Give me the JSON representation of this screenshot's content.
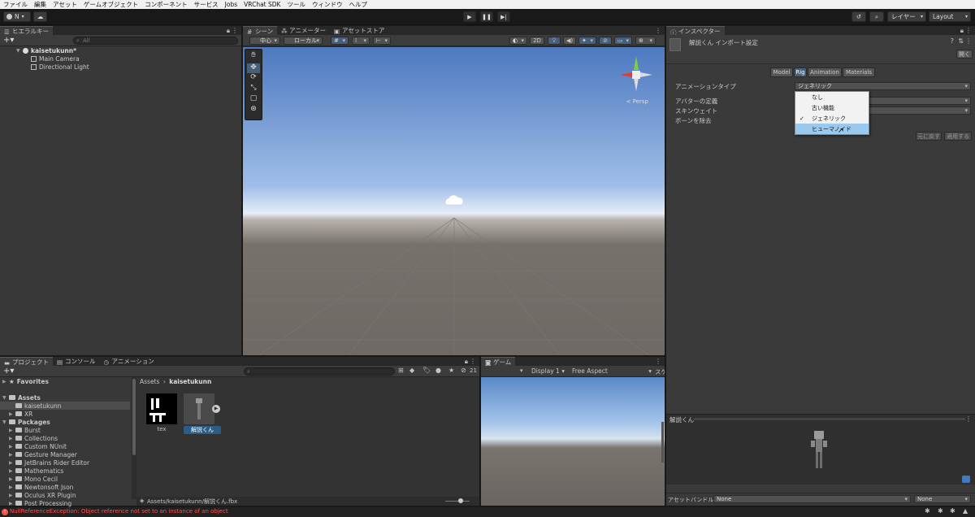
{
  "menu": [
    "ファイル",
    "編集",
    "アセット",
    "ゲームオブジェクト",
    "コンポーネント",
    "サービス",
    "Jobs",
    "VRChat SDK",
    "ツール",
    "ウィンドウ",
    "ヘルプ"
  ],
  "toolbar": {
    "account": "N",
    "layers": "レイヤー",
    "layout": "Layout"
  },
  "hierarchy": {
    "tab": "ヒエラルキー",
    "search_placeholder": "All",
    "items": [
      {
        "label": "kaisetukunn*",
        "bold": true
      },
      {
        "label": "Main Camera"
      },
      {
        "label": "Directional Light"
      }
    ]
  },
  "scene": {
    "tabs": [
      "シーン",
      "アニメーター",
      "アセットストア"
    ],
    "pivot": "中心",
    "space": "ローカル",
    "mode_2d": "2D",
    "persp": "< Persp"
  },
  "inspector": {
    "tab": "インスペクター",
    "title": "解説くん インポート設定",
    "open_button": "開く",
    "tabs": [
      "Model",
      "Rig",
      "Animation",
      "Materials"
    ],
    "active_tab": "Rig",
    "fields": [
      {
        "label": "アニメーションタイプ",
        "value": "ジェネリック"
      },
      {
        "label": "アバターの定義",
        "value": ""
      },
      {
        "label": "スキンウェイト",
        "value": ""
      },
      {
        "label": "ボーンを除去",
        "value": ""
      }
    ],
    "revert_button": "元に戻す",
    "apply_button": "適用する",
    "dropdown_options": [
      "なし",
      "古い機能",
      "ジェネリック",
      "ヒューマノイド"
    ],
    "checked_option": "ジェネリック",
    "highlighted_option": "ヒューマノイド",
    "preview_title": "解説くん",
    "asset_bundle_label": "アセットバンドル",
    "asset_bundle_value": "None",
    "asset_bundle_variant": "None"
  },
  "project": {
    "tabs": [
      "プロジェクト",
      "コンソール",
      "アニメーション"
    ],
    "badge_count": "21",
    "favorites": "Favorites",
    "assets": "Assets",
    "assets_children": [
      "kaisetukunn",
      "XR"
    ],
    "packages": "Packages",
    "packages_children": [
      "Burst",
      "Collections",
      "Custom NUnit",
      "Gesture Manager",
      "JetBrains Rider Editor",
      "Mathematics",
      "Mono Cecil",
      "Newtonsoft Json",
      "Oculus XR Plugin",
      "Post Processing"
    ],
    "breadcrumb_root": "Assets",
    "breadcrumb_current": "kaisetukunn",
    "files": [
      {
        "name": "tex"
      },
      {
        "name": "解説くん"
      }
    ],
    "status_path": "Assets/kaisetukunn/解説くん.fbx"
  },
  "game": {
    "tab": "ゲーム",
    "display": "Display 1",
    "aspect": "Free Aspect",
    "scale": "スケ"
  },
  "statusbar": {
    "error": "NullReferenceException: Object reference not set to an instance of an object"
  },
  "colors": {
    "accent": "#46607c",
    "selection": "#2c5d87",
    "error": "#ff5050",
    "highlight": "#99c9ef"
  }
}
